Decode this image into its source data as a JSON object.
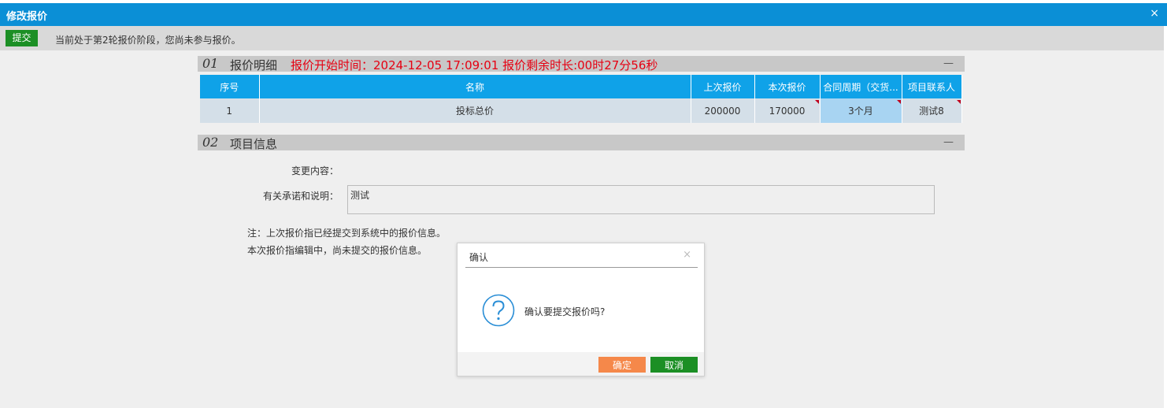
{
  "window": {
    "title": "修改报价",
    "close_symbol": "×"
  },
  "toolbar": {
    "submit_label": "提交",
    "notice": "当前处于第2轮报价阶段，您尚未参与报价。"
  },
  "section1": {
    "number": "01",
    "title": "报价明细",
    "timer_text": "报价开始时间：2024-12-05 17:09:01 报价剩余时长:00时27分56秒",
    "collapse_symbol": "—"
  },
  "table": {
    "headers": [
      "序号",
      "名称",
      "上次报价",
      "本次报价",
      "合同周期（交货...",
      "项目联系人"
    ],
    "rows": [
      {
        "index": "1",
        "name": "投标总价",
        "last_price": "200000",
        "current_price": "170000",
        "period": "3个月",
        "contact": "测试8"
      }
    ]
  },
  "section2": {
    "number": "02",
    "title": "项目信息",
    "collapse_symbol": "—",
    "change_label": "变更内容：",
    "promise_label": "有关承诺和说明：",
    "promise_value": "测试"
  },
  "notes": {
    "line1": "注：上次报价指已经提交到系统中的报价信息。",
    "line2": "本次报价指编辑中，尚未提交的报价信息。"
  },
  "dialog": {
    "title": "确认",
    "close_symbol": "×",
    "message": "确认要提交报价吗?",
    "icon": "question-circle-icon",
    "ok_label": "确定",
    "cancel_label": "取消"
  },
  "colors": {
    "header_blue": "#0b8fd6",
    "table_header": "#0fa2e8",
    "submit_green": "#1c8f25",
    "timer_red": "#e60012",
    "ok_orange": "#f5884a"
  }
}
